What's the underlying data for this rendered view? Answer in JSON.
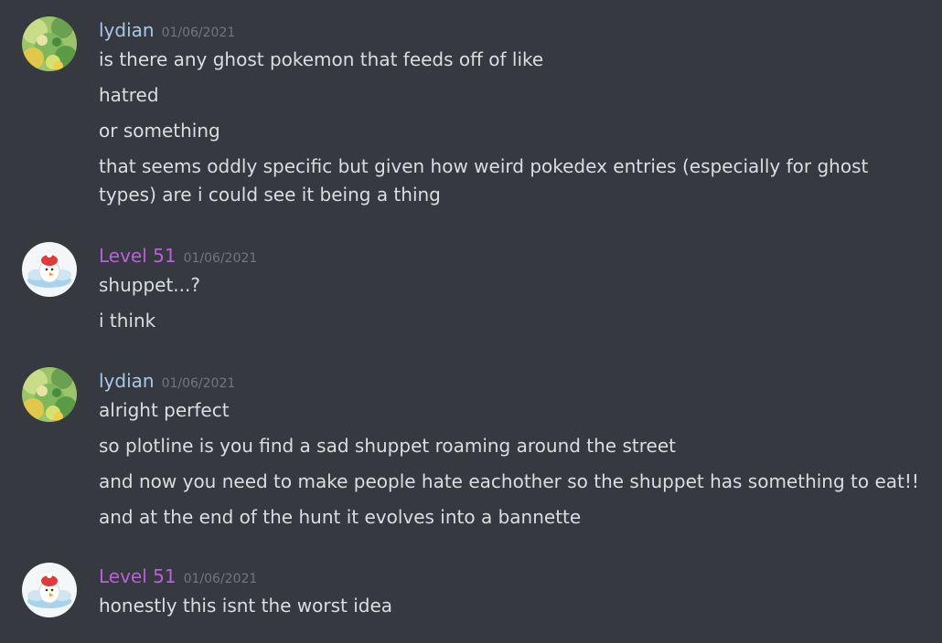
{
  "messages": [
    {
      "author": "lydian",
      "timestamp": "01/06/2021",
      "avatar": "lydian-avatar",
      "lines": [
        "is there any ghost pokemon that feeds off of like",
        "hatred",
        "or something",
        "that seems oddly specific but given how weird pokedex entries (especially for ghost types) are i could see it being a thing"
      ]
    },
    {
      "author": "Level 51",
      "timestamp": "01/06/2021",
      "avatar": "level51-avatar",
      "lines": [
        "shuppet...?",
        "i think"
      ]
    },
    {
      "author": "lydian",
      "timestamp": "01/06/2021",
      "avatar": "lydian-avatar",
      "lines": [
        "alright perfect",
        "so plotline is you find a sad shuppet roaming around the street",
        "and now you need to make people hate eachother so the shuppet has something to eat!!",
        "and at the end of the hunt it evolves into a bannette"
      ]
    },
    {
      "author": "Level 51",
      "timestamp": "01/06/2021",
      "avatar": "level51-avatar",
      "lines": [
        "honestly this isnt the worst idea"
      ]
    }
  ],
  "colors": {
    "background": "#36393f",
    "lydian_name": "#a8c8ea",
    "level51_name": "#b662d8",
    "timestamp": "#72767d",
    "text": "#dcddde"
  }
}
